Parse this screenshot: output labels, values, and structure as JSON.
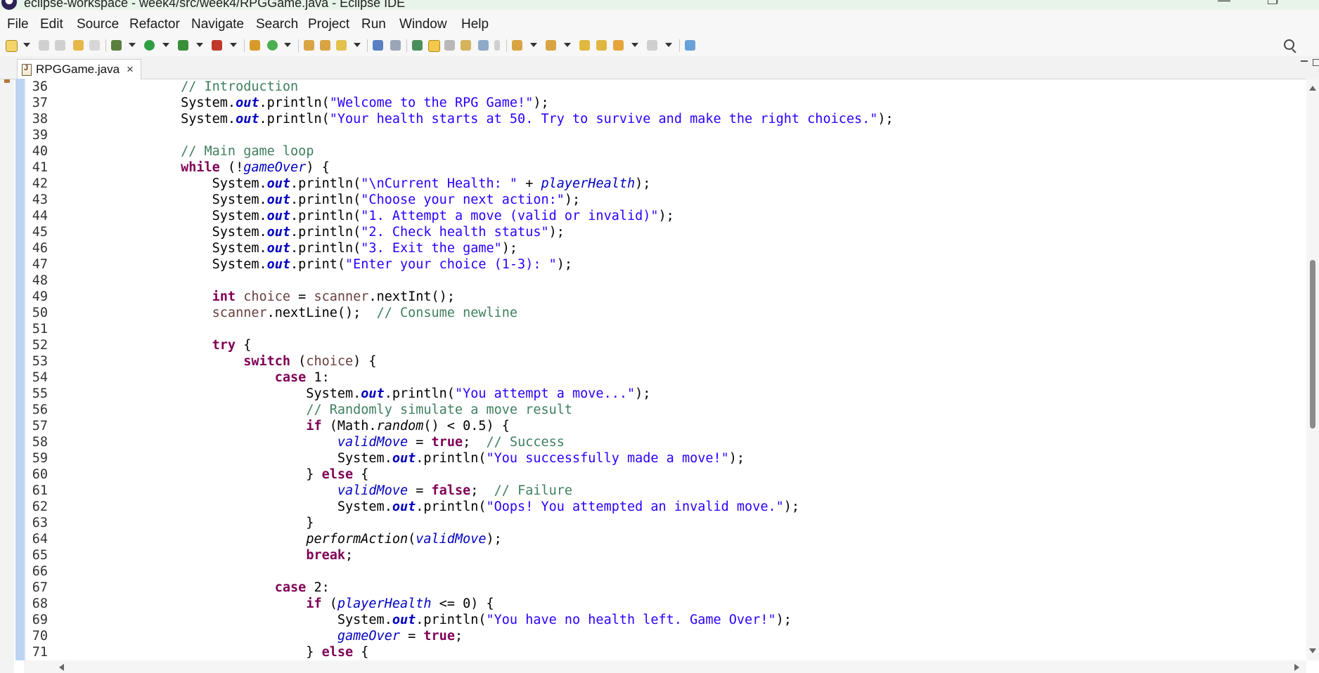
{
  "window": {
    "title": "eclipse-workspace - week4/src/week4/RPGGame.java - Eclipse IDE"
  },
  "menu": [
    "File",
    "Edit",
    "Source",
    "Refactor",
    "Navigate",
    "Search",
    "Project",
    "Run",
    "Window",
    "Help"
  ],
  "editor": {
    "tab_label": "RPGGame.java",
    "tab_close": "×"
  },
  "colors": {
    "keyword": "#7f0055",
    "string": "#2a00ff",
    "comment": "#3f7f5f",
    "field": "#0000c0",
    "change_ruler": "#bcd3f2"
  },
  "icons": [
    "new-icon",
    "save-icon",
    "save-all-icon",
    "undo-icon",
    "redo-icon",
    "debug-icon",
    "run-icon",
    "coverage-icon",
    "external-tools-icon",
    "new-java-project-icon",
    "new-package-icon",
    "new-class-icon",
    "open-type-icon",
    "open-task-icon",
    "search-icon",
    "toggle-mark-occurrences-icon",
    "toggle-block-selection-icon",
    "show-whitespace-icon",
    "next-annotation-icon",
    "previous-annotation-icon",
    "back-icon",
    "forward-icon",
    "pin-editor-icon",
    "java-file-icon",
    "close-icon",
    "minimize-icon",
    "maximize-icon"
  ],
  "code": {
    "lines": [
      {
        "n": "36",
        "parts": [
          [
            "        ",
            ""
          ],
          [
            "// Introduction",
            "cm"
          ]
        ]
      },
      {
        "n": "37",
        "parts": [
          [
            "        System.",
            ""
          ],
          [
            "out",
            "sfld"
          ],
          [
            ".println(",
            ""
          ],
          [
            "\"Welcome to the RPG Game!\"",
            "str"
          ],
          [
            ");",
            ""
          ]
        ]
      },
      {
        "n": "38",
        "parts": [
          [
            "        System.",
            ""
          ],
          [
            "out",
            "sfld"
          ],
          [
            ".println(",
            ""
          ],
          [
            "\"Your health starts at 50. Try to survive and make the right choices.\"",
            "str"
          ],
          [
            ");",
            ""
          ]
        ]
      },
      {
        "n": "39",
        "parts": [
          [
            "",
            ""
          ]
        ]
      },
      {
        "n": "40",
        "parts": [
          [
            "        ",
            ""
          ],
          [
            "// Main game loop",
            "cm"
          ]
        ]
      },
      {
        "n": "41",
        "parts": [
          [
            "        ",
            ""
          ],
          [
            "while",
            "kw"
          ],
          [
            " (!",
            ""
          ],
          [
            "gameOver",
            "fld"
          ],
          [
            ") {",
            ""
          ]
        ]
      },
      {
        "n": "42",
        "parts": [
          [
            "            System.",
            ""
          ],
          [
            "out",
            "sfld"
          ],
          [
            ".println(",
            ""
          ],
          [
            "\"\\nCurrent Health: \"",
            "str"
          ],
          [
            " + ",
            ""
          ],
          [
            "playerHealth",
            "fld"
          ],
          [
            ");",
            ""
          ]
        ]
      },
      {
        "n": "43",
        "parts": [
          [
            "            System.",
            ""
          ],
          [
            "out",
            "sfld"
          ],
          [
            ".println(",
            ""
          ],
          [
            "\"Choose your next action:\"",
            "str"
          ],
          [
            ");",
            ""
          ]
        ]
      },
      {
        "n": "44",
        "parts": [
          [
            "            System.",
            ""
          ],
          [
            "out",
            "sfld"
          ],
          [
            ".println(",
            ""
          ],
          [
            "\"1. Attempt a move (valid or invalid)\"",
            "str"
          ],
          [
            ");",
            ""
          ]
        ]
      },
      {
        "n": "45",
        "parts": [
          [
            "            System.",
            ""
          ],
          [
            "out",
            "sfld"
          ],
          [
            ".println(",
            ""
          ],
          [
            "\"2. Check health status\"",
            "str"
          ],
          [
            ");",
            ""
          ]
        ]
      },
      {
        "n": "46",
        "parts": [
          [
            "            System.",
            ""
          ],
          [
            "out",
            "sfld"
          ],
          [
            ".println(",
            ""
          ],
          [
            "\"3. Exit the game\"",
            "str"
          ],
          [
            ");",
            ""
          ]
        ]
      },
      {
        "n": "47",
        "parts": [
          [
            "            System.",
            ""
          ],
          [
            "out",
            "sfld"
          ],
          [
            ".print(",
            ""
          ],
          [
            "\"Enter your choice (1-3): \"",
            "str"
          ],
          [
            ");",
            ""
          ]
        ]
      },
      {
        "n": "48",
        "parts": [
          [
            "",
            ""
          ]
        ]
      },
      {
        "n": "49",
        "parts": [
          [
            "            ",
            ""
          ],
          [
            "int",
            "kw"
          ],
          [
            " ",
            ""
          ],
          [
            "choice",
            "lvar"
          ],
          [
            " = ",
            ""
          ],
          [
            "scanner",
            "lvar"
          ],
          [
            ".nextInt();",
            ""
          ]
        ]
      },
      {
        "n": "50",
        "parts": [
          [
            "            ",
            ""
          ],
          [
            "scanner",
            "lvar"
          ],
          [
            ".nextLine();  ",
            ""
          ],
          [
            "// Consume newline",
            "cm"
          ]
        ]
      },
      {
        "n": "51",
        "parts": [
          [
            "",
            ""
          ]
        ]
      },
      {
        "n": "52",
        "parts": [
          [
            "            ",
            ""
          ],
          [
            "try",
            "kw"
          ],
          [
            " {",
            ""
          ]
        ]
      },
      {
        "n": "53",
        "parts": [
          [
            "                ",
            ""
          ],
          [
            "switch",
            "kw"
          ],
          [
            " (",
            ""
          ],
          [
            "choice",
            "lvar"
          ],
          [
            ") {",
            ""
          ]
        ]
      },
      {
        "n": "54",
        "parts": [
          [
            "                    ",
            ""
          ],
          [
            "case",
            "kw"
          ],
          [
            " 1:",
            ""
          ]
        ]
      },
      {
        "n": "55",
        "parts": [
          [
            "                        System.",
            ""
          ],
          [
            "out",
            "sfld"
          ],
          [
            ".println(",
            ""
          ],
          [
            "\"You attempt a move...\"",
            "str"
          ],
          [
            ");",
            ""
          ]
        ]
      },
      {
        "n": "56",
        "parts": [
          [
            "                        ",
            ""
          ],
          [
            "// Randomly simulate a move result",
            "cm"
          ]
        ]
      },
      {
        "n": "57",
        "parts": [
          [
            "                        ",
            ""
          ],
          [
            "if",
            "kw"
          ],
          [
            " (Math.",
            ""
          ],
          [
            "random",
            "smeth"
          ],
          [
            "() < 0.5) {",
            ""
          ]
        ]
      },
      {
        "n": "58",
        "parts": [
          [
            "                            ",
            ""
          ],
          [
            "validMove",
            "fld"
          ],
          [
            " = ",
            ""
          ],
          [
            "true",
            "kw"
          ],
          [
            ";  ",
            ""
          ],
          [
            "// Success",
            "cm"
          ]
        ]
      },
      {
        "n": "59",
        "parts": [
          [
            "                            System.",
            ""
          ],
          [
            "out",
            "sfld"
          ],
          [
            ".println(",
            ""
          ],
          [
            "\"You successfully made a move!\"",
            "str"
          ],
          [
            ");",
            ""
          ]
        ]
      },
      {
        "n": "60",
        "parts": [
          [
            "                        } ",
            ""
          ],
          [
            "else",
            "kw"
          ],
          [
            " {",
            ""
          ]
        ]
      },
      {
        "n": "61",
        "parts": [
          [
            "                            ",
            ""
          ],
          [
            "validMove",
            "fld"
          ],
          [
            " = ",
            ""
          ],
          [
            "false",
            "kw"
          ],
          [
            ";  ",
            ""
          ],
          [
            "// Failure",
            "cm"
          ]
        ]
      },
      {
        "n": "62",
        "parts": [
          [
            "                            System.",
            ""
          ],
          [
            "out",
            "sfld"
          ],
          [
            ".println(",
            ""
          ],
          [
            "\"Oops! You attempted an invalid move.\"",
            "str"
          ],
          [
            ");",
            ""
          ]
        ]
      },
      {
        "n": "63",
        "parts": [
          [
            "                        }",
            ""
          ]
        ]
      },
      {
        "n": "64",
        "parts": [
          [
            "                        ",
            ""
          ],
          [
            "performAction",
            "smeth"
          ],
          [
            "(",
            ""
          ],
          [
            "validMove",
            "fld"
          ],
          [
            ");",
            ""
          ]
        ]
      },
      {
        "n": "65",
        "parts": [
          [
            "                        ",
            ""
          ],
          [
            "break",
            "kw"
          ],
          [
            ";",
            ""
          ]
        ]
      },
      {
        "n": "66",
        "parts": [
          [
            "",
            ""
          ]
        ]
      },
      {
        "n": "67",
        "parts": [
          [
            "                    ",
            ""
          ],
          [
            "case",
            "kw"
          ],
          [
            " 2:",
            ""
          ]
        ]
      },
      {
        "n": "68",
        "parts": [
          [
            "                        ",
            ""
          ],
          [
            "if",
            "kw"
          ],
          [
            " (",
            ""
          ],
          [
            "playerHealth",
            "fld"
          ],
          [
            " <= 0) {",
            ""
          ]
        ]
      },
      {
        "n": "69",
        "parts": [
          [
            "                            System.",
            ""
          ],
          [
            "out",
            "sfld"
          ],
          [
            ".println(",
            ""
          ],
          [
            "\"You have no health left. Game Over!\"",
            "str"
          ],
          [
            ");",
            ""
          ]
        ]
      },
      {
        "n": "70",
        "parts": [
          [
            "                            ",
            ""
          ],
          [
            "gameOver",
            "fld"
          ],
          [
            " = ",
            ""
          ],
          [
            "true",
            "kw"
          ],
          [
            ";",
            ""
          ]
        ]
      },
      {
        "n": "71",
        "parts": [
          [
            "                        } ",
            ""
          ],
          [
            "else",
            "kw"
          ],
          [
            " {",
            ""
          ]
        ]
      }
    ]
  }
}
